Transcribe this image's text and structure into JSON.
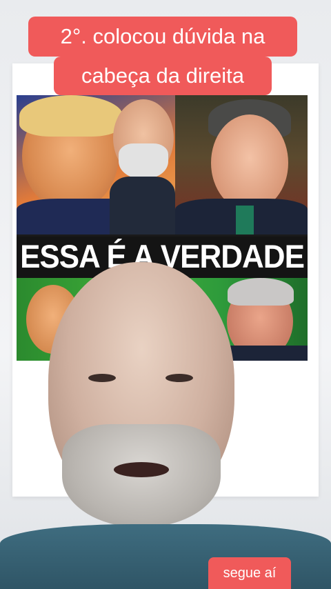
{
  "caption": {
    "line1": "2°. colocou dúvida na",
    "line2": "cabeça da direita",
    "background_color": "#f05a5a",
    "text_color": "#ffffff"
  },
  "thumbnail": {
    "banner_text": "ESSA É A VERDADE"
  },
  "follow_button": {
    "label": "segue aí",
    "background_color": "#f05a5a"
  }
}
